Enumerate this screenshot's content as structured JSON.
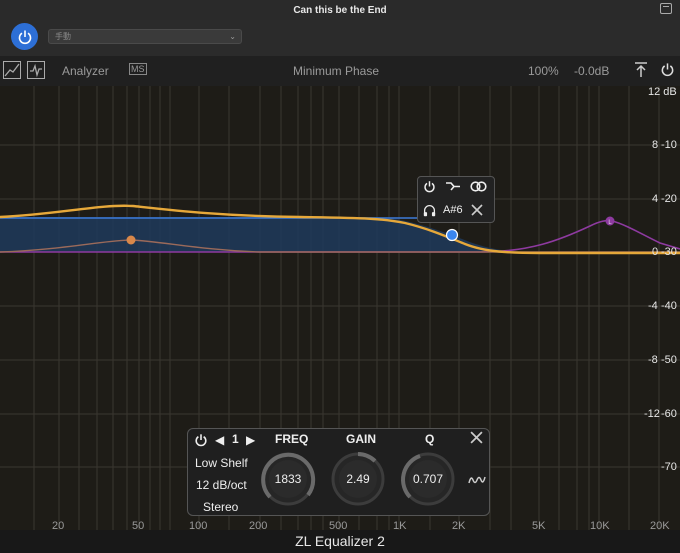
{
  "window": {
    "title": "Can this be the End"
  },
  "host": {
    "preset_label": "手動"
  },
  "toolbar": {
    "analyzer_label": "Analyzer",
    "phase_label": "Minimum Phase",
    "scale_value": "100%",
    "output_gain": "-0.0dB"
  },
  "plot": {
    "db_labels_left": [
      "12 dB",
      "8",
      "4",
      "0",
      "-4",
      "-8",
      "-12"
    ],
    "db_labels_right": [
      "-10",
      "-20",
      "-30",
      "-40",
      "-50",
      "-60",
      "-70"
    ],
    "freq_labels": [
      "20",
      "50",
      "100",
      "200",
      "500",
      "1K",
      "2K",
      "5K",
      "10K",
      "20K"
    ]
  },
  "popup": {
    "note": "A#6"
  },
  "band": {
    "index": "1",
    "type": "Low Shelf",
    "slope": "12 dB/oct",
    "stereo": "Stereo",
    "freq_label": "FREQ",
    "gain_label": "GAIN",
    "q_label": "Q",
    "freq_value": "1833",
    "gain_value": "2.49",
    "q_value": "0.707"
  },
  "colors": {
    "accent_blue": "#2d6fd6",
    "curve_orange": "#e6a83a",
    "curve_purple": "#8e3aa0",
    "fill_blue": "#1e3a5c"
  },
  "footer": {
    "title": "ZL Equalizer 2"
  }
}
